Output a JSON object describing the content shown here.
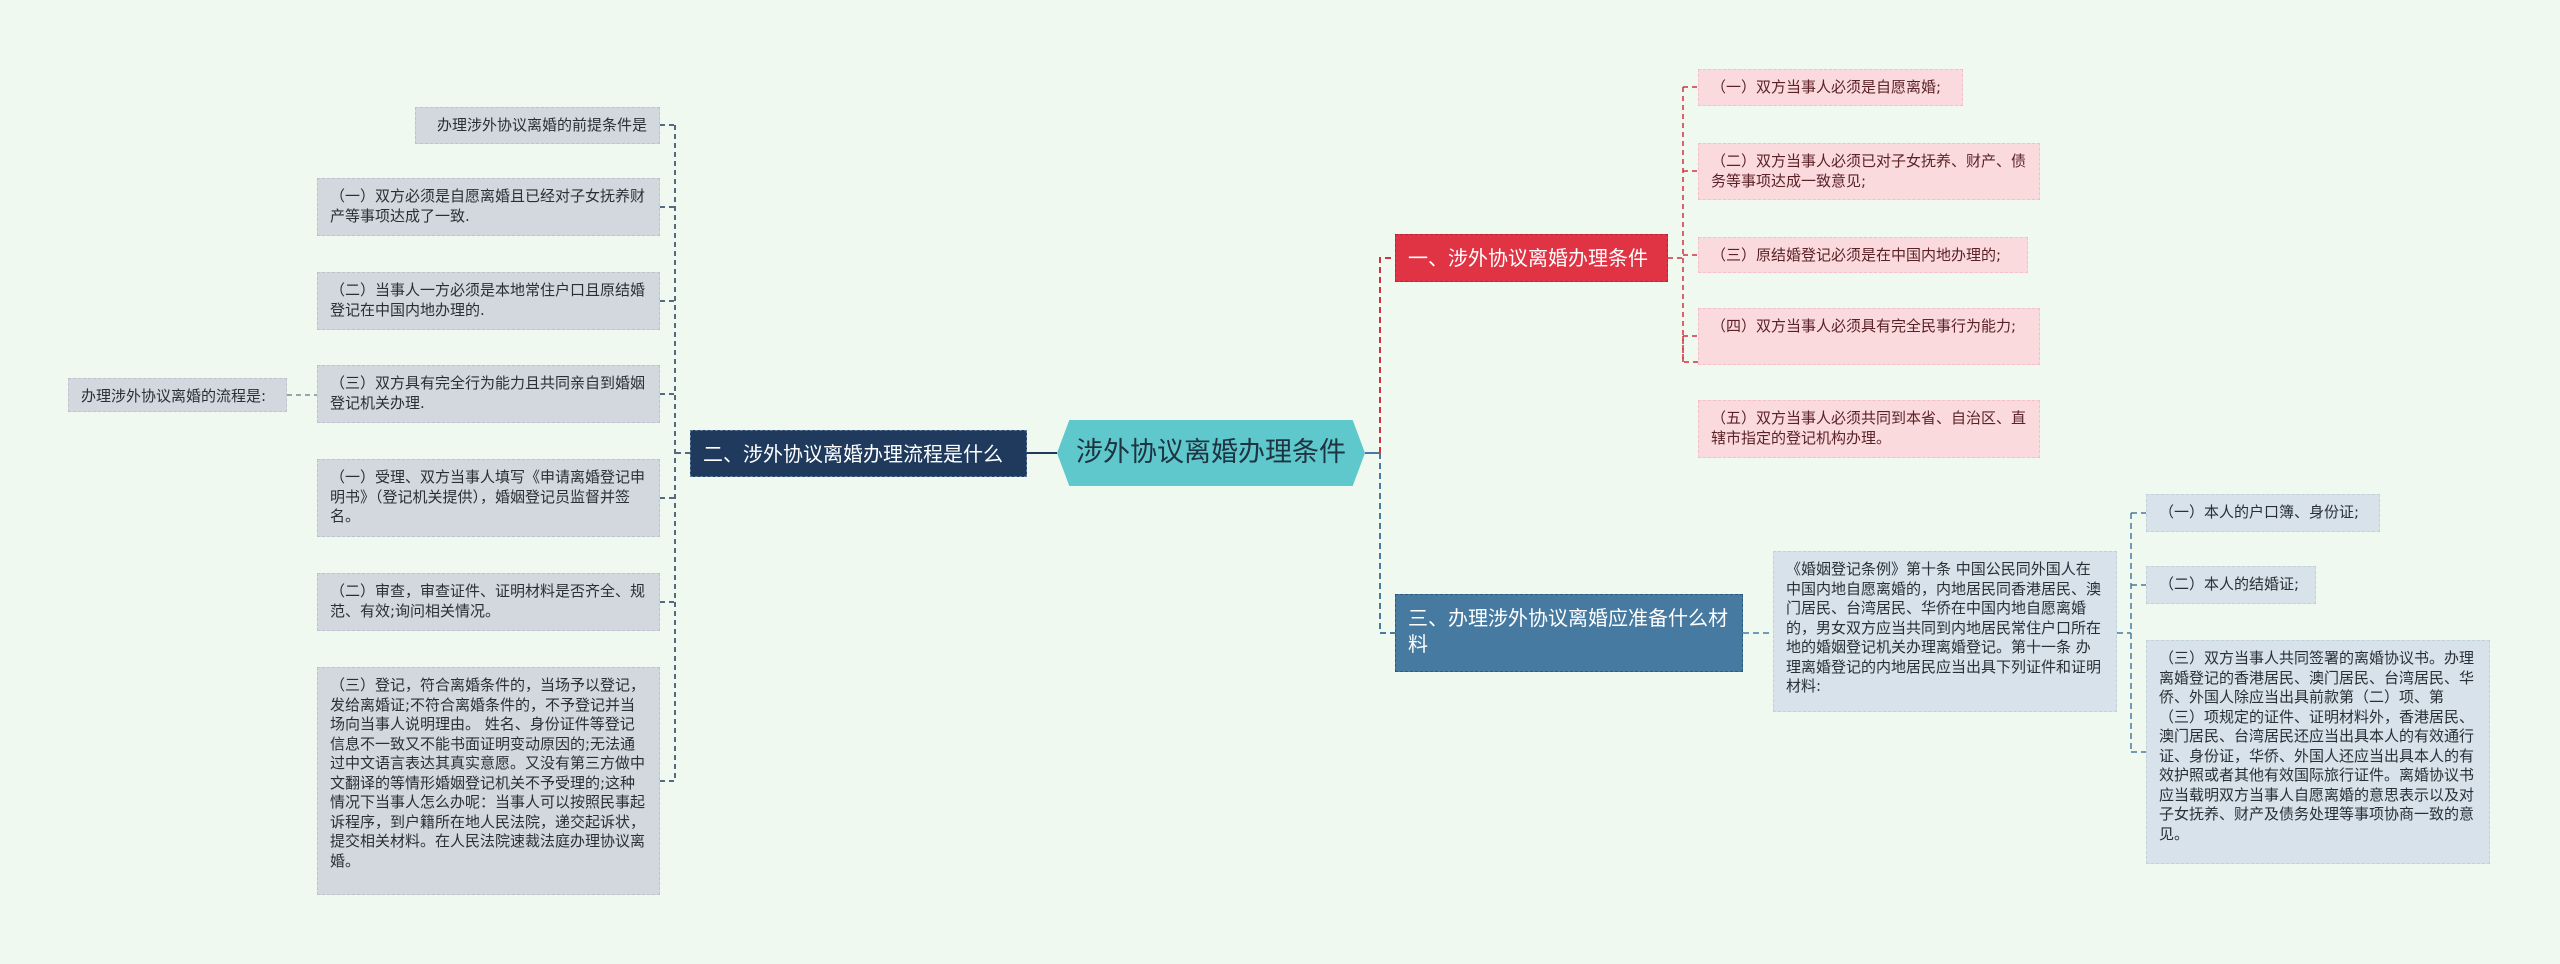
{
  "root": {
    "title": "涉外协议离婚办理条件"
  },
  "branches": [
    {
      "title": "一、涉外协议离婚办理条件",
      "color": "#e03445",
      "children": [
        "（一）双方当事人必须是自愿离婚;",
        "（二）双方当事人必须已对子女抚养、财产、债务等事项达成一致意见;",
        "（三）原结婚登记必须是在中国内地办理的;",
        "（四）双方当事人必须具有完全民事行为能力;",
        "（五）双方当事人必须共同到本省、自治区、直辖市指定的登记机构办理。"
      ]
    },
    {
      "title": "二、涉外协议离婚办理流程是什么",
      "color": "#1f3a5d",
      "children": [
        "办理涉外协议离婚的前提条件是",
        "（一）双方必须是自愿离婚且已经对子女抚养财产等事项达成了一致.",
        "（二）当事人一方必须是本地常住户口且原结婚登记在中国内地办理的.",
        "（三）双方具有完全行为能力且共同亲自到婚姻登记机关办理.",
        "（一）受理、双方当事人填写《申请离婚登记申明书》（登记机关提供），婚姻登记员监督并签名。",
        "（二）审查，审查证件、证明材料是否齐全、规范、有效;询问相关情况。",
        "（三）登记，符合离婚条件的，当场予以登记，发给离婚证;不符合离婚条件的，不予登记并当场向当事人说明理由。 姓名、身份证件等登记信息不一致又不能书面证明变动原因的;无法通过中文语言表达其真实意愿。又没有第三方做中文翻译的等情形婚姻登记机关不予受理的;这种情况下当事人怎么办呢：当事人可以按照民事起诉程序，到户籍所在地人民法院，递交起诉状，提交相关材料。在人民法院速裁法庭办理协议离婚。"
      ],
      "sub_label": "办理涉外协议离婚的流程是:"
    },
    {
      "title": "三、办理涉外协议离婚应准备什么材料",
      "color": "#477aa0",
      "intro": "《婚姻登记条例》第十条 中国公民同外国人在中国内地自愿离婚的，内地居民同香港居民、澳门居民、台湾居民、华侨在中国内地自愿离婚的，男女双方应当共同到内地居民常住户口所在地的婚姻登记机关办理离婚登记。第十一条 办理离婚登记的内地居民应当出具下列证件和证明材料:",
      "children": [
        "（一）本人的户口簿、身份证;",
        "（二）本人的结婚证;",
        "（三）双方当事人共同签署的离婚协议书。办理离婚登记的香港居民、澳门居民、台湾居民、华侨、外国人除应当出具前款第（二）项、第（三）项规定的证件、证明材料外，香港居民、澳门居民、台湾居民还应当出具本人的有效通行证、身份证，华侨、外国人还应当出具本人的有效护照或者其他有效国际旅行证件。离婚协议书应当载明双方当事人自愿离婚的意思表示以及对子女抚养、财产及债务处理等事项协商一致的意见。"
      ]
    }
  ]
}
